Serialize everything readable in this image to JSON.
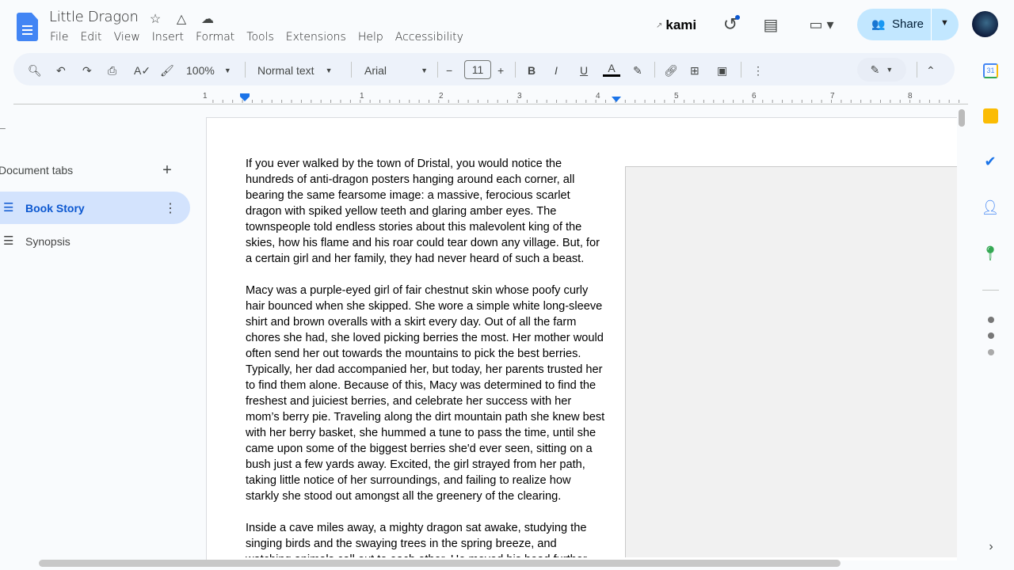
{
  "title": "Little Dragon",
  "menu": [
    "File",
    "Edit",
    "View",
    "Insert",
    "Format",
    "Tools",
    "Extensions",
    "Help",
    "Accessibility"
  ],
  "header": {
    "kami": "kami",
    "share": "Share"
  },
  "toolbar": {
    "zoom": "100%",
    "style": "Normal text",
    "font": "Arial",
    "font_size": "11"
  },
  "ruler": [
    "1",
    "1",
    "2",
    "3",
    "4",
    "5",
    "6",
    "7",
    "8"
  ],
  "sidebar": {
    "heading": "Document tabs",
    "tabs": [
      {
        "label": "Book Story"
      },
      {
        "label": "Synopsis"
      }
    ]
  },
  "document": {
    "paragraphs": [
      [
        "If you ever walked by the town of Dristal, you would notice the",
        "hundreds of anti-dragon posters hanging around each corner, all",
        "bearing the same fearsome image: a massive, ferocious scarlet",
        "dragon with spiked yellow teeth and glaring amber eyes. The",
        "townspeople told endless stories about this malevolent king of the",
        "skies, how his flame and his roar could tear down any village. But, for",
        "a certain girl and her family, they had never heard of such a beast."
      ],
      [
        "Macy was a purple-eyed girl of fair chestnut skin whose poofy curly",
        "hair bounced when she skipped. She wore a simple white long-sleeve",
        "shirt and brown overalls with a skirt every day. Out of all the farm",
        "chores she had, she loved picking berries the most. Her mother would",
        "often send her out towards the mountains to pick the best berries.",
        "Typically, her dad accompanied her, but today, her parents trusted her",
        "to find them alone. Because of this, Macy was determined to find the",
        "freshest and juiciest berries, and celebrate her success with her",
        "mom’s berry pie. Traveling along the dirt mountain path she knew best",
        "with her berry basket, she hummed a tune to pass the time, until she",
        "came upon some of the biggest berries she'd ever seen, sitting on a",
        "bush just a few yards away. Excited, the girl strayed from her path,",
        "taking little notice of her surroundings, and failing to realize how",
        "starkly she stood out amongst all the greenery of the clearing."
      ],
      [
        "Inside a cave miles away, a mighty dragon sat awake, studying the",
        "singing birds and the swaying trees in the spring breeze, and",
        "watching animals call out to each other. He moved his head further"
      ]
    ]
  }
}
